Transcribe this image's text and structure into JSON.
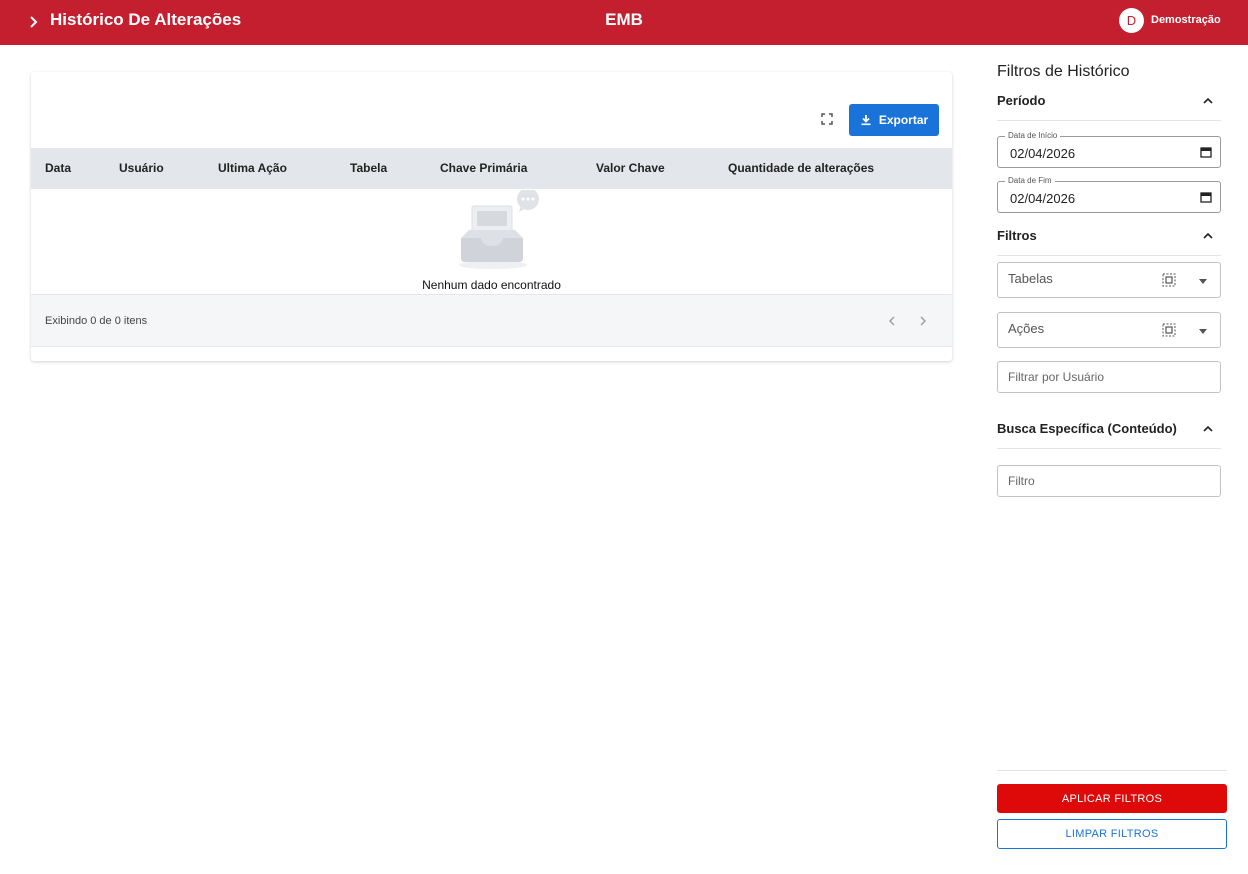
{
  "header": {
    "title": "Histórico De Alterações",
    "center_title": "EMB",
    "user_initial": "D",
    "user_name": "Demostração",
    "color": "#c41f2f"
  },
  "table": {
    "export_label": "Exportar",
    "columns": [
      "Data",
      "Usuário",
      "Ultima Ação",
      "Tabela",
      "Chave Primária",
      "Valor Chave",
      "Quantidade de alterações"
    ],
    "empty_message": "Nenhum dado encontrado",
    "pagination_info": "Exibindo 0 de 0 itens",
    "rows": []
  },
  "filters": {
    "panel_title": "Filtros de Histórico",
    "period": {
      "heading": "Período",
      "start_label": "Data de Início",
      "start_value": "02/04/2026",
      "end_label": "Data de Fim",
      "end_value": "02/04/2026"
    },
    "filters_section": {
      "heading": "Filtros",
      "tables_placeholder": "Tabelas",
      "actions_placeholder": "Ações",
      "user_placeholder": "Filtrar por Usuário"
    },
    "content_search": {
      "heading": "Busca Específica (Conteúdo)",
      "placeholder": "Filtro"
    },
    "apply_label": "APLICAR FILTROS",
    "clear_label": "LIMPAR FILTROS"
  },
  "colors": {
    "primary_red": "#c41f2f",
    "apply_red": "#de0a0a",
    "accent_blue": "#1a73d9"
  }
}
